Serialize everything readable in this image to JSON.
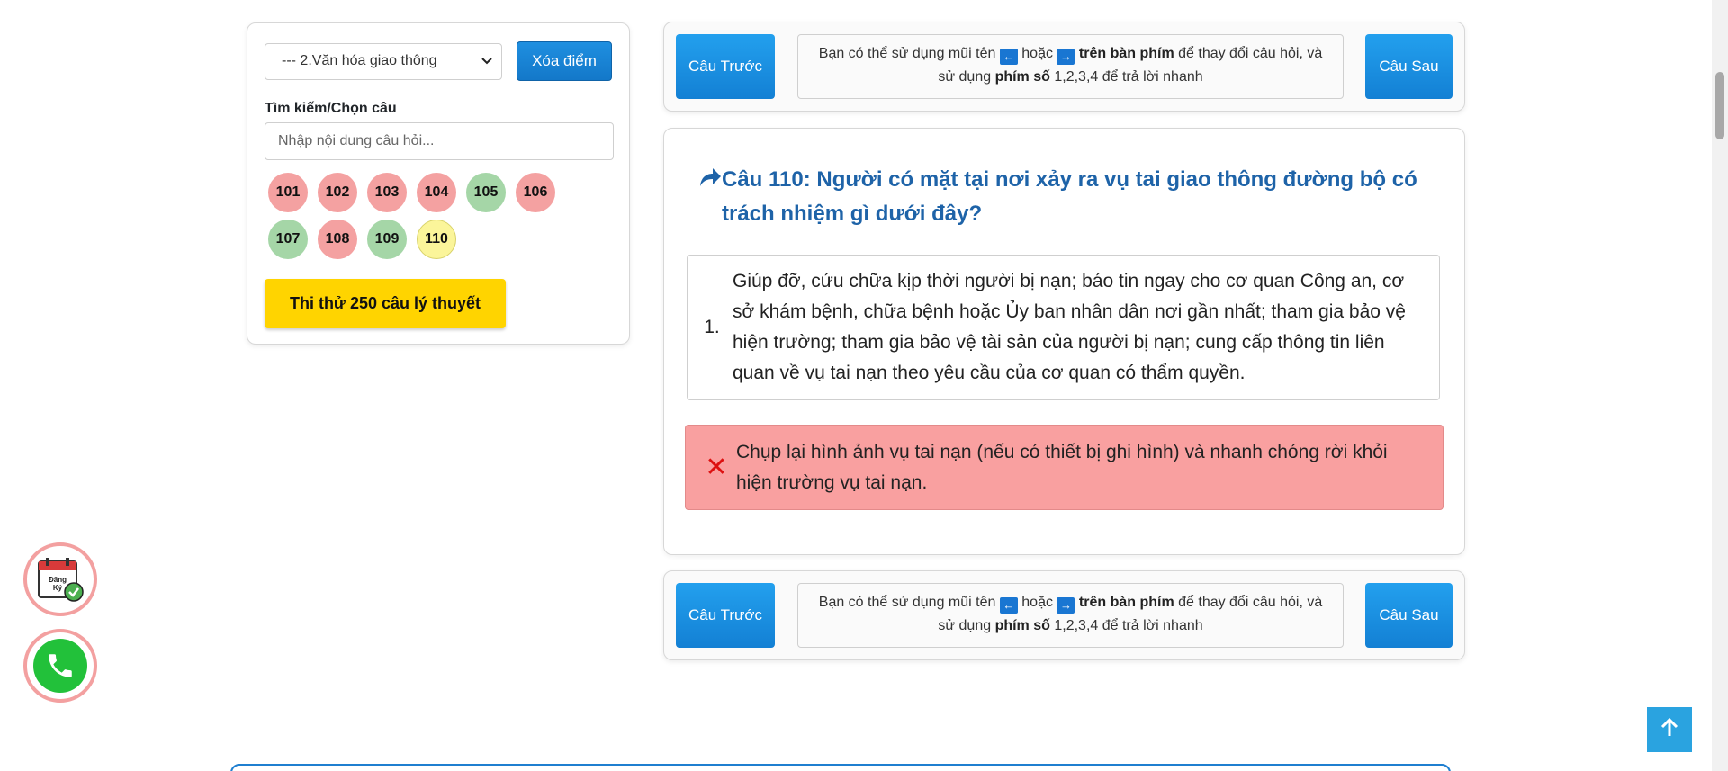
{
  "sidebar": {
    "category_select": "--- 2.Văn hóa giao thông",
    "clear_button": "Xóa điểm",
    "search_label": "Tìm kiếm/Chọn câu",
    "search_placeholder": "Nhập nội dung câu hỏi...",
    "question_numbers": [
      {
        "label": "101",
        "status": "wrong"
      },
      {
        "label": "102",
        "status": "wrong"
      },
      {
        "label": "103",
        "status": "wrong"
      },
      {
        "label": "104",
        "status": "wrong"
      },
      {
        "label": "105",
        "status": "right"
      },
      {
        "label": "106",
        "status": "wrong"
      },
      {
        "label": "107",
        "status": "right"
      },
      {
        "label": "108",
        "status": "wrong"
      },
      {
        "label": "109",
        "status": "right"
      },
      {
        "label": "110",
        "status": "current"
      }
    ],
    "test_button": "Thi thử 250 câu lý thuyết"
  },
  "nav": {
    "prev_label": "Câu Trước",
    "next_label": "Câu Sau",
    "hint_part1": "Bạn có thể sử dụng mũi tên",
    "hint_key_left": "←",
    "hint_or": "hoặc",
    "hint_key_right": "→",
    "hint_bold1": "trên bàn phím",
    "hint_part2": "để thay đổi câu hỏi, và",
    "hint_part3": "sử dụng",
    "hint_bold2": "phím số",
    "hint_part4": "1,2,3,4 để trả lời nhanh"
  },
  "question": {
    "title": "Câu 110: Người có mặt tại nơi xảy ra vụ tai giao thông đường bộ có trách nhiệm gì dưới đây?",
    "answers": [
      {
        "index": "1.",
        "text": "Giúp đỡ, cứu chữa kịp thời người bị nạn; báo tin ngay cho cơ quan Công an, cơ sở khám bệnh, chữa bệnh hoặc Ủy ban nhân dân nơi gần nhất; tham gia bảo vệ hiện trường; tham gia bảo vệ tài sản của người bị nạn; cung cấp thông tin liên quan về vụ tai nạn theo yêu cầu của cơ quan có thẩm quyền."
      },
      {
        "index": "✕",
        "text": "Chụp lại hình ảnh vụ tai nạn (nếu có thiết bị ghi hình) và nhanh chóng rời khỏi hiện trường vụ tai nạn."
      }
    ]
  },
  "floating": {
    "register_text_line1": "Đăng",
    "register_text_line2": "Ký"
  },
  "colors": {
    "primary": "#1378c9",
    "title": "#1e63a8",
    "wrong": "#f4a1a1",
    "right": "#a5d6a7",
    "current": "#fbf59a",
    "yellow": "#ffd400"
  }
}
